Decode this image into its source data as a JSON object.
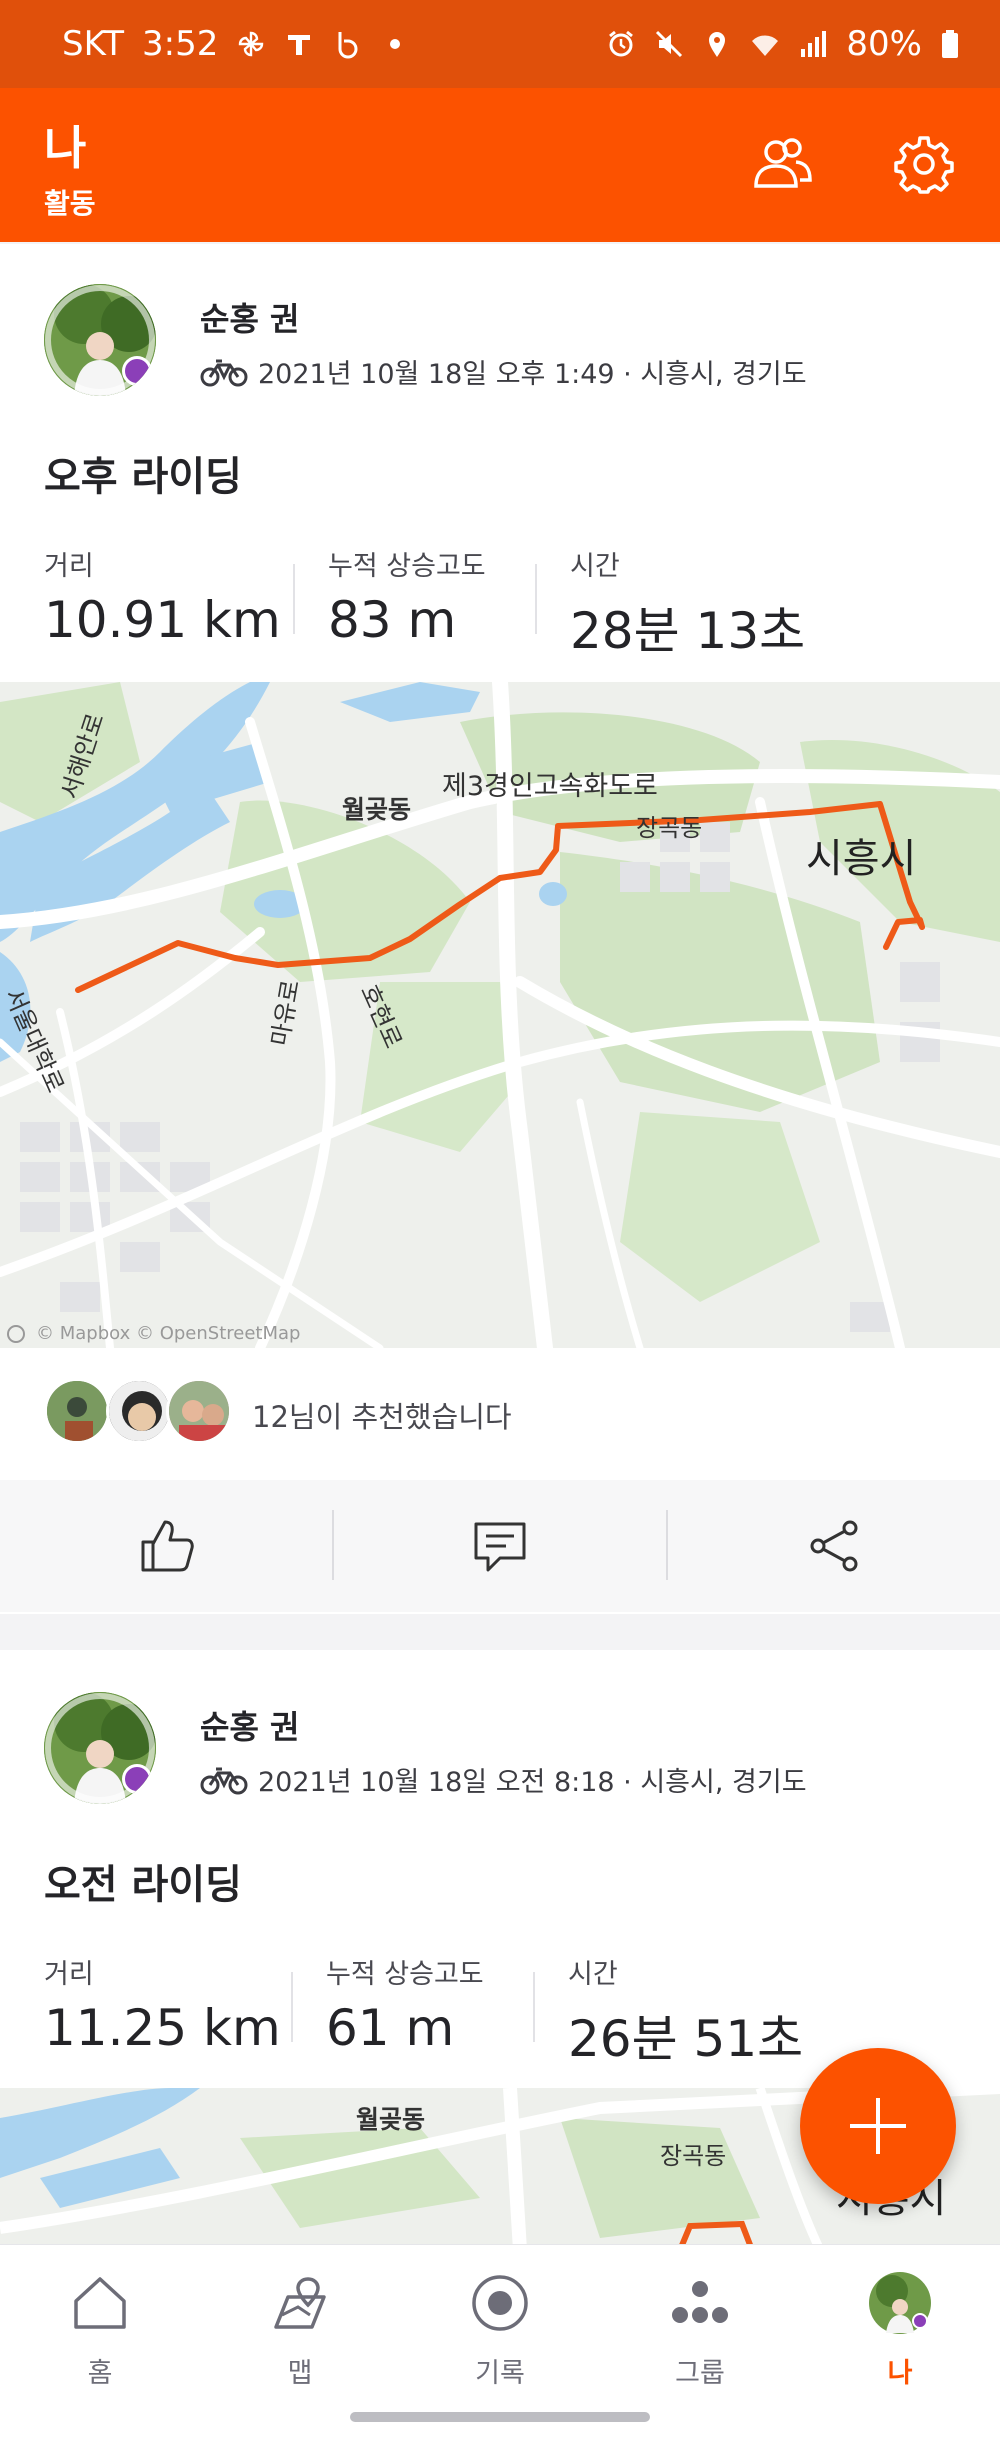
{
  "status_bar": {
    "carrier": "SKT",
    "time": "3:52",
    "battery": "80%",
    "icons_left": [
      "pinwheel-icon",
      "t-icon",
      "b-icon",
      "dot-icon"
    ],
    "icons_right": [
      "alarm-icon",
      "mute-icon",
      "location-icon",
      "wifi-icon",
      "signal-icon",
      "battery-icon"
    ]
  },
  "header": {
    "title": "나",
    "subtitle": "활동",
    "actions": [
      "friends-icon",
      "settings-icon"
    ]
  },
  "colors": {
    "brand": "#fc5200",
    "status_bar": "#e0500b",
    "route": "#ee5a18"
  },
  "activities": [
    {
      "athlete": "순홍 권",
      "sport_icon": "bike-icon",
      "datetime_location": "2021년 10월 18일 오후 1:49 · 시흥시, 경기도",
      "title": "오후 라이딩",
      "stats": [
        {
          "label": "거리",
          "value": "10.91 km"
        },
        {
          "label": "누적 상승고도",
          "value": "83 m"
        },
        {
          "label": "시간",
          "value": "28분 13초"
        }
      ],
      "map": {
        "labels": {
          "expressway": "제3경인고속화도로",
          "district1": "월곶동",
          "district2": "장곡동",
          "city": "시흥시",
          "road_left": "서해안로",
          "road_vertical": "서울대학로",
          "road_mid": "마유로",
          "road_right": "호현로"
        },
        "attribution": "© Mapbox © OpenStreetMap"
      },
      "kudos_text": "12님이 추천했습니다",
      "action_icons": [
        "like-icon",
        "comment-icon",
        "share-icon"
      ]
    },
    {
      "athlete": "순홍 권",
      "sport_icon": "bike-icon",
      "datetime_location": "2021년 10월 18일 오전 8:18 · 시흥시, 경기도",
      "title": "오전 라이딩",
      "stats": [
        {
          "label": "거리",
          "value": "11.25 km"
        },
        {
          "label": "누적 상승고도",
          "value": "61 m"
        },
        {
          "label": "시간",
          "value": "26분 51초"
        }
      ],
      "map": {
        "labels": {
          "district1": "월곶동",
          "district2": "장곡동",
          "city": "시흥시"
        }
      }
    }
  ],
  "fab": {
    "icon": "plus-icon"
  },
  "bottom_nav": [
    {
      "label": "홈",
      "icon": "home-icon",
      "active": false
    },
    {
      "label": "맵",
      "icon": "map-icon",
      "active": false
    },
    {
      "label": "기록",
      "icon": "record-icon",
      "active": false
    },
    {
      "label": "그룹",
      "icon": "groups-icon",
      "active": false
    },
    {
      "label": "나",
      "icon": "profile-avatar-icon",
      "active": true
    }
  ]
}
